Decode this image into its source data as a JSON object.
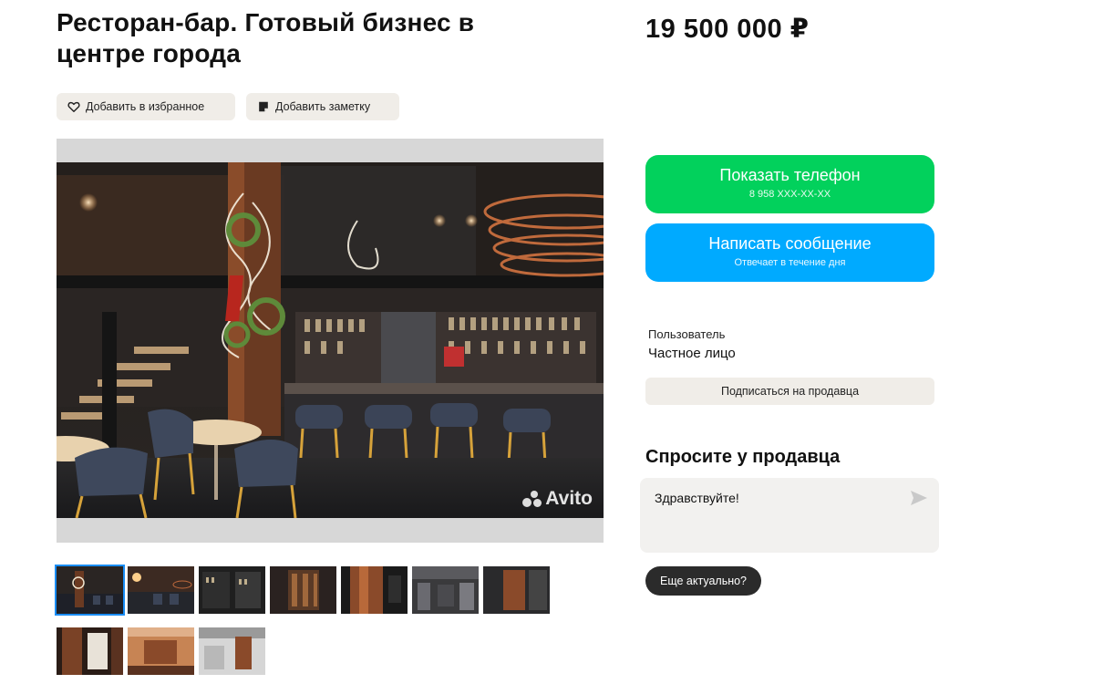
{
  "listing": {
    "title": "Ресторан-бар. Готовый бизнес в центре города",
    "price": "19 500 000 ₽"
  },
  "actions": {
    "favorite_label": "Добавить в избранное",
    "note_label": "Добавить заметку"
  },
  "gallery": {
    "watermark": "Avito",
    "thumbnail_count": 10,
    "active_index": 0
  },
  "contact": {
    "phone_button": "Показать телефон",
    "phone_masked": "8 958 XXX-XX-XX",
    "message_button": "Написать сообщение",
    "message_sub": "Отвечает в течение дня"
  },
  "seller": {
    "role": "Пользователь",
    "type": "Частное лицо",
    "subscribe_label": "Подписаться на продавца"
  },
  "ask": {
    "title": "Спросите у продавца",
    "input_value": "Здравствуйте!",
    "quick_reply": "Еще актуально?"
  },
  "colors": {
    "phone_green": "#02d15c",
    "message_blue": "#00aaff",
    "chip_bg": "#f0ede8"
  },
  "icons": {
    "favorite": "heart-icon",
    "note": "note-icon",
    "send": "send-icon",
    "watermark": "avito-logo-icon"
  }
}
